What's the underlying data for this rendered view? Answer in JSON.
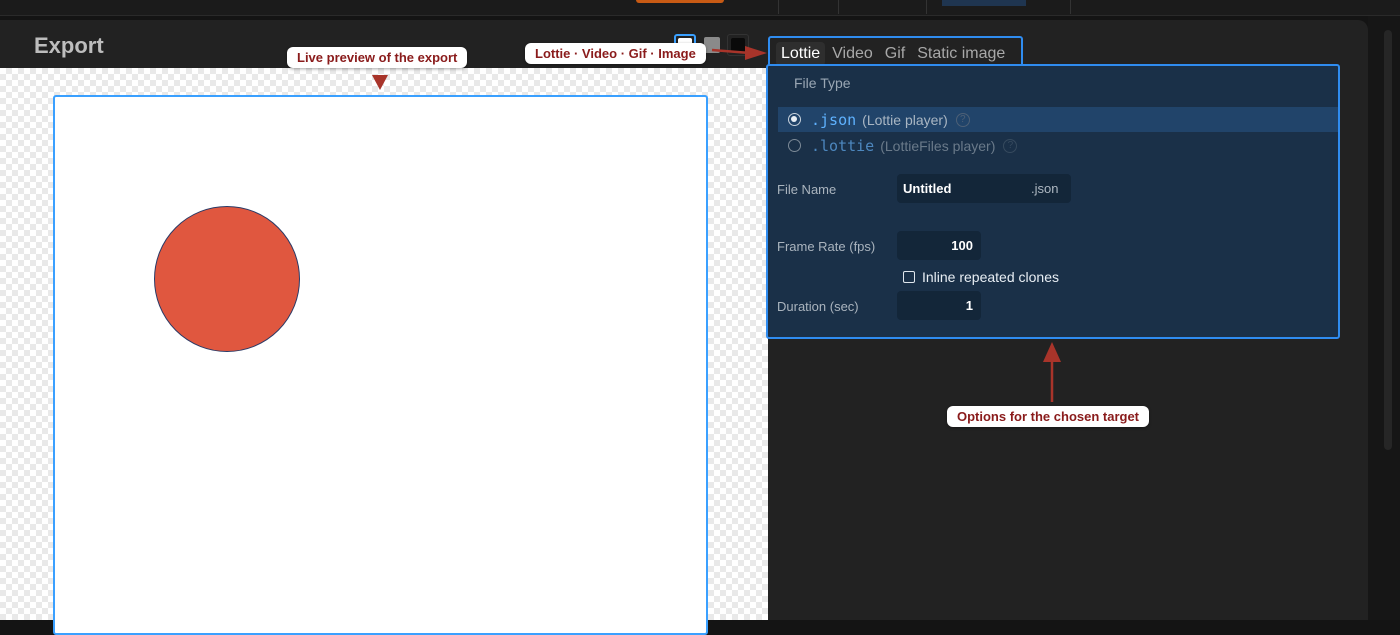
{
  "dialog": {
    "title": "Export"
  },
  "preview": {
    "shape_color": "#e0573f",
    "background_swatches": [
      {
        "name": "transparent",
        "color": "#ffffff",
        "selected": true
      },
      {
        "name": "gray",
        "color": "#8a8a8a",
        "selected": false
      },
      {
        "name": "black",
        "color": "#0a0a0a",
        "selected": false
      }
    ]
  },
  "tabs": [
    {
      "label": "Lottie",
      "active": true
    },
    {
      "label": "Video",
      "active": false
    },
    {
      "label": "Gif",
      "active": false
    },
    {
      "label": "Static image",
      "active": false
    }
  ],
  "options": {
    "file_type_label": "File Type",
    "file_types": [
      {
        "ext": ".json",
        "desc": "(Lottie player)",
        "selected": true
      },
      {
        "ext": ".lottie",
        "desc": "(LottieFiles player)",
        "selected": false
      }
    ],
    "file_name_label": "File Name",
    "file_name_value": "Untitled",
    "file_name_suffix": ".json",
    "frame_rate_label": "Frame Rate (fps)",
    "frame_rate_value": "100",
    "inline_clones_label": "Inline repeated clones",
    "inline_clones_checked": false,
    "duration_label": "Duration (sec)",
    "duration_value": "1"
  },
  "annotations": {
    "preview": "Live preview of the export",
    "tabs": "Lottie · Video · Gif · Image",
    "options": "Options for the chosen target"
  },
  "colors": {
    "annotation_red": "#a8342a",
    "highlight_blue": "#2f8cf0",
    "panel_bg": "#1a3048"
  }
}
